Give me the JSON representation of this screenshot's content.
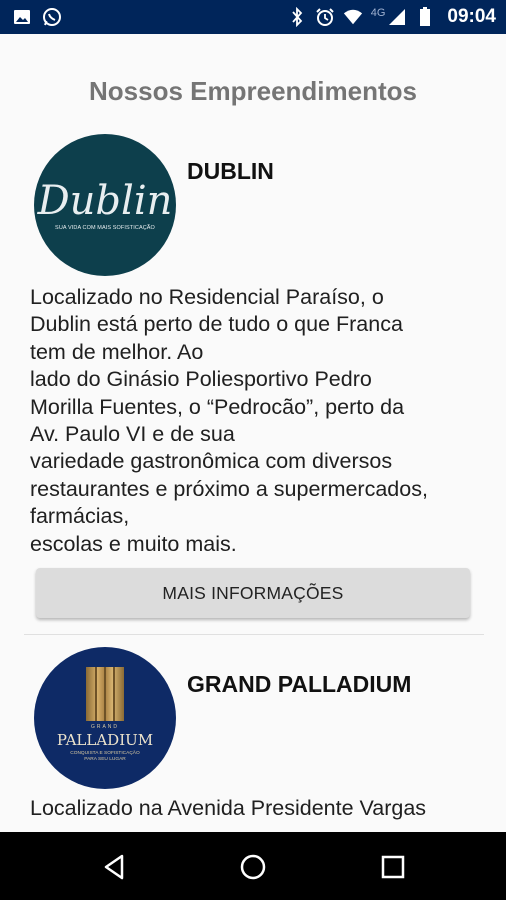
{
  "status_bar": {
    "time": "09:04",
    "network": "4G",
    "icons_left": [
      "image-icon",
      "whatsapp-icon"
    ],
    "icons_right": [
      "bluetooth-icon",
      "alarm-icon",
      "wifi-icon",
      "cell-signal-icon",
      "battery-icon"
    ]
  },
  "page": {
    "title": "Nossos Empreendimentos"
  },
  "cards": [
    {
      "name": "DUBLIN",
      "logo_text": "Dublin",
      "logo_tagline": "SUA VIDA COM MAIS SOFISTICAÇÃO",
      "logo_bg": "#0d3f4c",
      "description": "Localizado no Residencial Paraíso, o\nDublin está perto de tudo o que Franca\ntem de melhor. Ao\nlado do Ginásio Poliesportivo Pedro\nMorilla Fuentes, o “Pedrocão”, perto da\nAv. Paulo VI e de sua\nvariedade gastronômica com diversos\nrestaurantes e próximo a supermercados,\nfarmácias,\nescolas e muito mais.",
      "button_label": "MAIS INFORMAÇÕES"
    },
    {
      "name": "GRAND PALLADIUM",
      "logo_small": "GRAND",
      "logo_text": "PALLADIUM",
      "logo_tagline": "CONQUISTA E SOFISTICAÇÃO\nPARA SEU LUGAR",
      "logo_bg": "#0e2a66",
      "description": "Localizado na Avenida Presidente Vargas"
    }
  ],
  "nav_bar": {
    "buttons": [
      "back-icon",
      "home-icon",
      "recents-icon"
    ]
  }
}
